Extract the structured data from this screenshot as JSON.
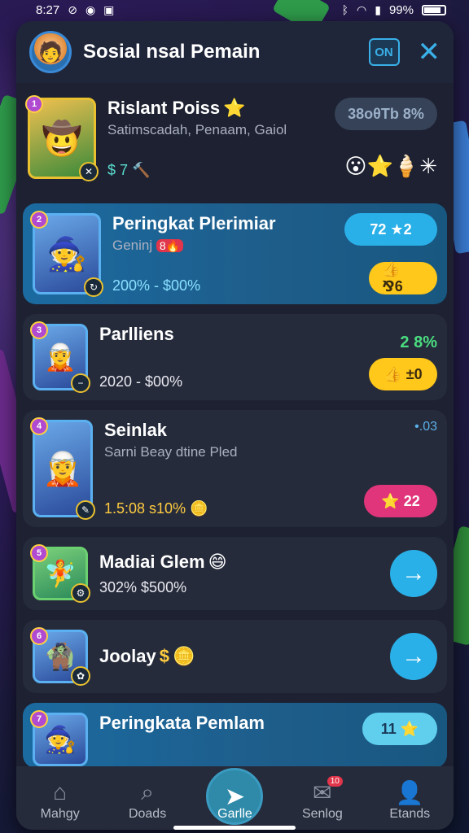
{
  "status_bar": {
    "time": "8:27",
    "battery": "99%"
  },
  "header": {
    "title": "Sosial nsal Pemain",
    "toggle": "ON",
    "close_icon": "close-icon"
  },
  "cards": [
    {
      "name": "Rislant Poiss",
      "sub": "Satimscadah, Penaam, Gaiol",
      "value": "$ 7",
      "pill": "38oθTb 8%",
      "icons": "😮⭐🍦✳"
    },
    {
      "name": "Peringkat Plerimiar",
      "sub": "Geninj",
      "sub_badge": "8🔥",
      "value": "200% - $00%",
      "pill_top": "72 ★2",
      "pill_bottom": "👍 ⅋6"
    },
    {
      "name": "Parlliens",
      "value": "2020 - $00%",
      "stat": "2 8%",
      "pill_bottom": "👍 ±0"
    },
    {
      "name": "Seinlak",
      "sub": "Sarni Beay dtine Pled",
      "value": "1.5:08 s10%",
      "dots": "•.03",
      "pill_bottom": "⭐ 22"
    },
    {
      "name": "Madiai Glem",
      "value": "302% $500%"
    },
    {
      "name": "Joolay",
      "value_prefix": "$"
    },
    {
      "name": "Peringkata Pemlam",
      "pill": "11 ⭐"
    }
  ],
  "nav": [
    {
      "label": "Mahgy",
      "icon": "home-icon"
    },
    {
      "label": "Doads",
      "icon": "search-icon"
    },
    {
      "label": "Garlle",
      "icon": "send-icon"
    },
    {
      "label": "Senlog",
      "icon": "mail-icon",
      "badge": "10"
    },
    {
      "label": "Etands",
      "icon": "profile-icon"
    }
  ],
  "colors": {
    "accent": "#2ab0e8",
    "panel": "#1d2131",
    "card": "#262b3b",
    "highlight": "#1b6aa0",
    "yellow": "#ffc81a",
    "pink": "#e0357a"
  }
}
